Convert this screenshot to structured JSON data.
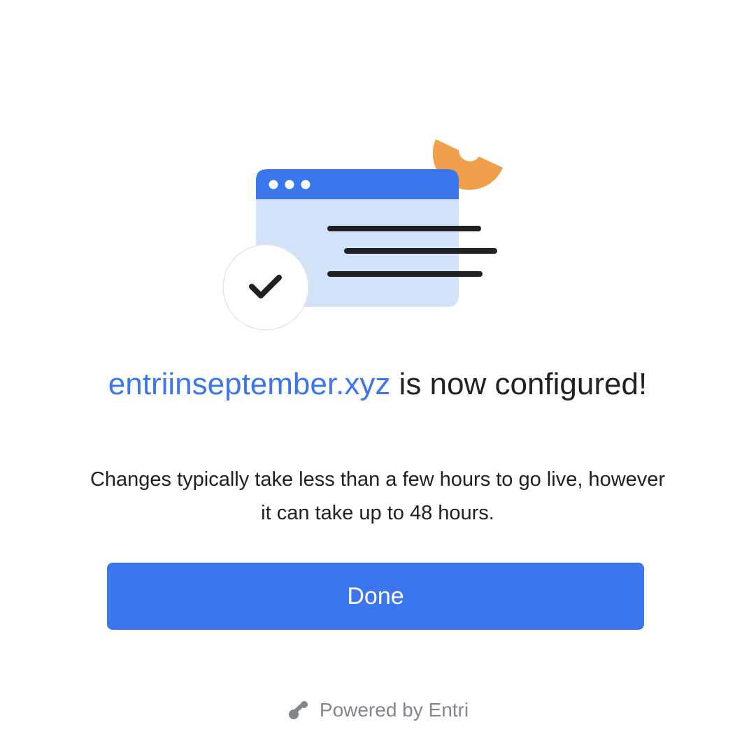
{
  "headline": {
    "domain": "entriinseptember.xyz",
    "suffix": " is now configured!"
  },
  "subtext": "Changes typically take less than a few hours to go live, however it can take up to 48 hours.",
  "done_button": {
    "label": "Done"
  },
  "footer": {
    "powered_by": "Powered by Entri",
    "logo_icon": "entri-logo-icon"
  },
  "illustration": {
    "browser_window_icon": "browser-window-icon",
    "check_icon": "checkmark-icon",
    "accent_shape": "orange-semicircle-decoration"
  },
  "colors": {
    "accent": "#3b76ec",
    "window_body": "#d2e2f9",
    "orange": "#f0a04b",
    "text": "#202124",
    "muted": "#80868b"
  }
}
